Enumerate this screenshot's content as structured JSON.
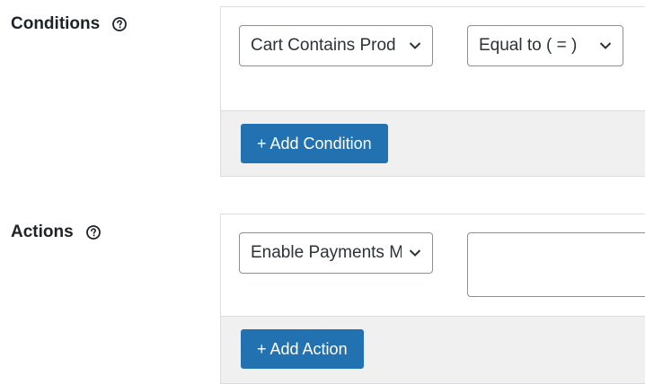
{
  "conditions": {
    "label": "Conditions",
    "help_icon": "question-circle-icon",
    "type_select": {
      "value": "Cart Contains Prod",
      "icon": "chevron-down-icon"
    },
    "operator_select": {
      "value": "Equal to ( = )",
      "icon": "chevron-down-icon"
    },
    "add_button_label": "+ Add Condition"
  },
  "actions": {
    "label": "Actions",
    "help_icon": "question-circle-icon",
    "type_select": {
      "value": "Enable Payments M",
      "icon": "chevron-down-icon"
    },
    "value_input": "",
    "add_button_label": "+ Add Action"
  },
  "colors": {
    "primary_button": "#2271b1",
    "panel_footer": "#f0f0f1",
    "border": "#dcdcde",
    "text": "#1d2327"
  }
}
